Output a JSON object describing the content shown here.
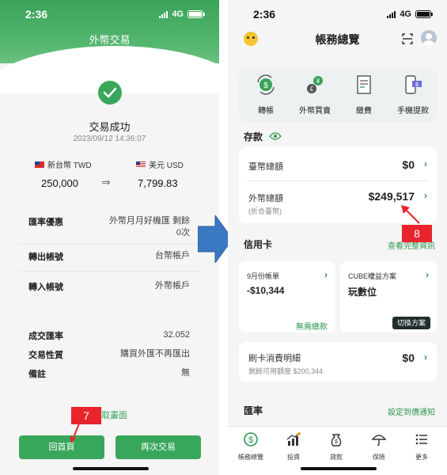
{
  "left": {
    "status": {
      "time": "2:36",
      "network": "4G"
    },
    "header_title": "外幣交易",
    "success_title": "交易成功",
    "success_time": "2023/09/12 14:36:07",
    "from_currency": "新台幣 TWD",
    "to_currency": "美元 USD",
    "from_amount": "250,000",
    "to_amount": "7,799.83",
    "details1": [
      {
        "label": "匯率優惠",
        "value_line1": "外幣月月好機匯 剩餘",
        "value_line2": "0次"
      },
      {
        "label": "轉出帳號",
        "value": "台幣帳戶"
      },
      {
        "label": "轉入帳號",
        "value": "外幣帳戶"
      }
    ],
    "details2": [
      {
        "label": "成交匯率",
        "value": "32.052"
      },
      {
        "label": "交易性質",
        "value": "購買外匯不再匯出"
      },
      {
        "label": "備註",
        "value": "無"
      }
    ],
    "save_link": "取畫面",
    "home_button": "回首頁",
    "again_button": "再次交易",
    "step_badge": "7"
  },
  "right": {
    "status": {
      "time": "2:36",
      "network": "4G"
    },
    "header_title": "帳務總覽",
    "quick_actions": [
      {
        "label": "轉帳",
        "icon": "transfer-icon"
      },
      {
        "label": "外幣買賣",
        "icon": "currency-exchange-icon"
      },
      {
        "label": "繳費",
        "icon": "bill-icon"
      },
      {
        "label": "手機提款",
        "icon": "phone-withdraw-icon"
      }
    ],
    "deposit_title": "存款",
    "twd_label": "臺幣總額",
    "twd_value": "$0",
    "fx_label": "外幣總額",
    "fx_sub": "(折合臺幣)",
    "fx_value": "$249,517",
    "step_badge": "8",
    "credit_title": "信用卡",
    "credit_link": "查看完整資訊",
    "bill_card": {
      "title": "9月份帳單",
      "value": "-$10,344",
      "link": "無需繳款"
    },
    "cube_card": {
      "title": "CUBE權益方案",
      "value": "玩數位",
      "button": "切換方案"
    },
    "card_detail": {
      "label": "刷卡消費明細",
      "value": "$0",
      "sub": "剩餘可用額度 $200,344"
    },
    "rate_title": "匯率",
    "rate_link": "設定到價通知",
    "nav": [
      {
        "label": "帳務總覽",
        "icon": "dollar-icon"
      },
      {
        "label": "投資",
        "icon": "chart-icon"
      },
      {
        "label": "貸款",
        "icon": "loan-icon"
      },
      {
        "label": "保險",
        "icon": "umbrella-icon"
      },
      {
        "label": "更多",
        "icon": "menu-icon"
      }
    ]
  },
  "colors": {
    "green": "#39a75b",
    "badge": "#e8242c",
    "arrow": "#3a78c2"
  }
}
